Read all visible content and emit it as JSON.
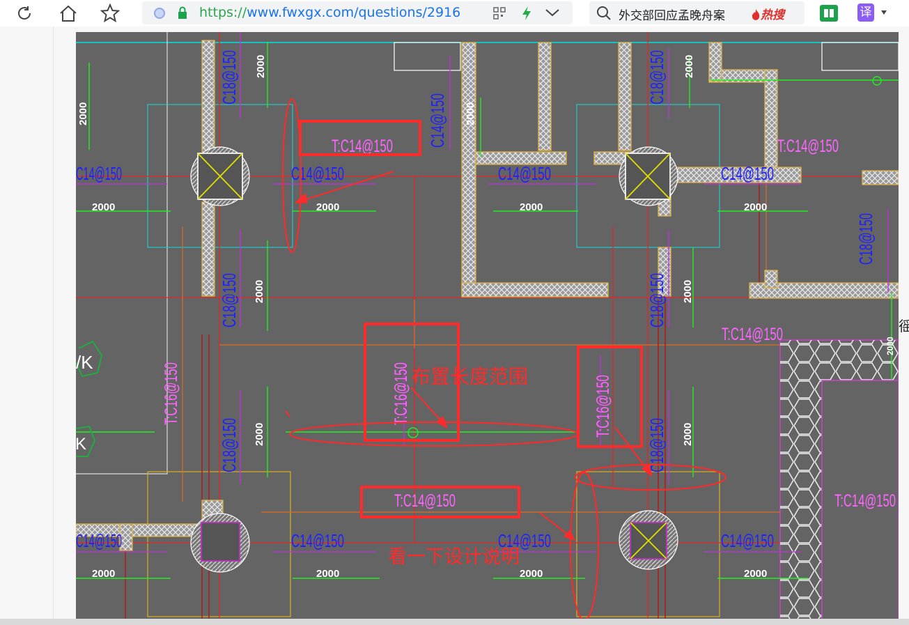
{
  "browser": {
    "url_scheme": "https://",
    "url_rest": "www.fwxgx.com/questions/2916",
    "search_text": "外交部回应孟晚舟案",
    "hot_label": "热搜",
    "translate_label": "译",
    "icons": [
      "refresh-icon",
      "home-icon",
      "star-icon",
      "shield-icon",
      "lock-icon",
      "qr-icon",
      "bolt-icon",
      "chevron-down-icon",
      "search-icon",
      "fire-icon",
      "reader-icon",
      "translate-icon"
    ]
  },
  "side_char": "徭",
  "drawing": {
    "spacing_2000": "2000",
    "rebar_c14": "C14@150",
    "rebar_c18": "C18@150",
    "top_c14": "T:C14@150",
    "top_c16": "T:C16@150",
    "label_k1": "/K",
    "label_k2": "K"
  },
  "annotations": {
    "range_note": "布置长度范围",
    "design_note": "看一下设计说明"
  },
  "colors": {
    "cad_bg": "#646464",
    "red_markup": "#ff2a2a",
    "rebar_blue": "#1c1cff",
    "top_magenta": "#ff66ff",
    "dim_green": "#00ff00",
    "wall_orange": "#e8b030"
  }
}
